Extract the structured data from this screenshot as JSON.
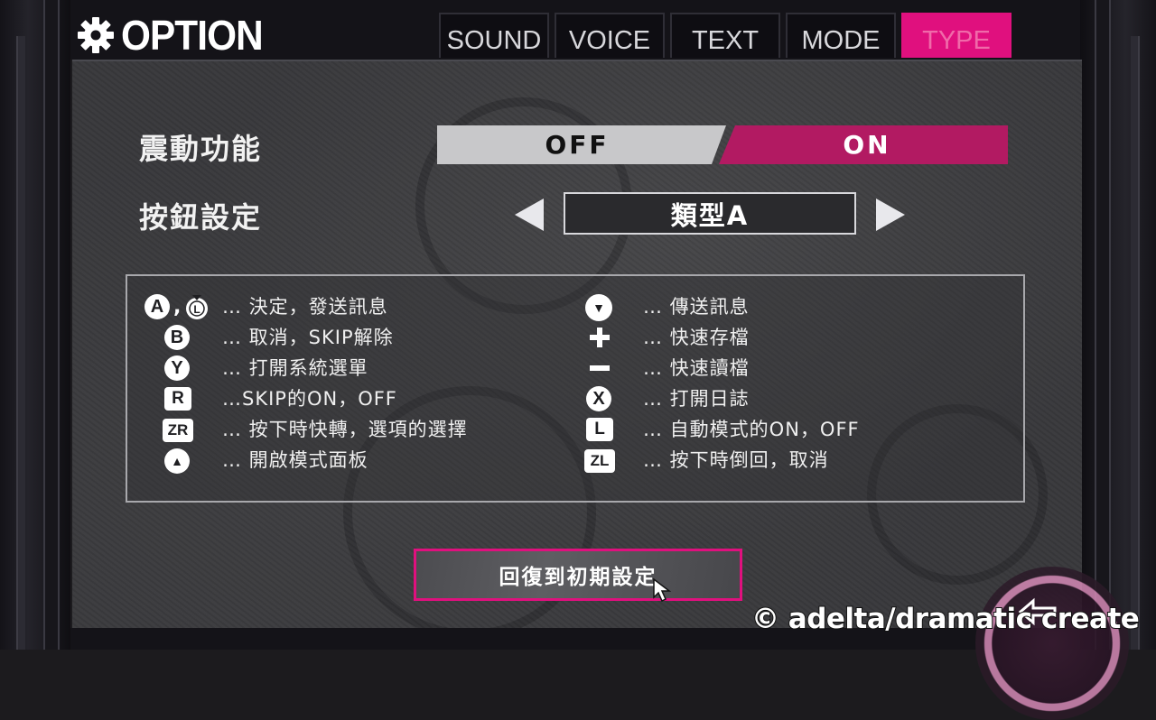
{
  "header": {
    "title": "OPTION",
    "title_icon": "gear-icon"
  },
  "tabs": [
    {
      "label": "SOUND",
      "active": false
    },
    {
      "label": "VOICE",
      "active": false
    },
    {
      "label": "TEXT",
      "active": false
    },
    {
      "label": "MODE",
      "active": false
    },
    {
      "label": "TYPE",
      "active": true
    }
  ],
  "settings": {
    "vibration": {
      "label": "震動功能",
      "off_label": "OFF",
      "on_label": "ON",
      "value": "ON"
    },
    "button_config": {
      "label": "按鈕設定",
      "value": "類型A",
      "prev_icon": "arrow-left-icon",
      "next_icon": "arrow-right-icon"
    }
  },
  "legend": {
    "left": [
      {
        "icon": "A,L",
        "icon_name": "a-button-and-l-stick-icon",
        "text": "… 決定，發送訊息"
      },
      {
        "icon": "B",
        "icon_name": "b-button-icon",
        "text": "… 取消，SKIP解除"
      },
      {
        "icon": "Y",
        "icon_name": "y-button-icon",
        "text": "… 打開系統選單"
      },
      {
        "icon": "R",
        "icon_name": "r-button-icon",
        "text": "…SKIP的ON，OFF"
      },
      {
        "icon": "ZR",
        "icon_name": "zr-button-icon",
        "text": "… 按下時快轉，選項的選擇"
      },
      {
        "icon": "▲",
        "icon_name": "dpad-up-icon",
        "text": "… 開啟模式面板"
      }
    ],
    "right": [
      {
        "icon": "▼",
        "icon_name": "dpad-down-icon",
        "text": "… 傳送訊息"
      },
      {
        "icon": "+",
        "icon_name": "plus-button-icon",
        "text": "… 快速存檔"
      },
      {
        "icon": "−",
        "icon_name": "minus-button-icon",
        "text": "… 快速讀檔"
      },
      {
        "icon": "X",
        "icon_name": "x-button-icon",
        "text": "… 打開日誌"
      },
      {
        "icon": "L",
        "icon_name": "l-button-icon",
        "text": "… 自動模式的ON，OFF"
      },
      {
        "icon": "ZL",
        "icon_name": "zl-button-icon",
        "text": "… 按下時倒回，取消"
      }
    ]
  },
  "reset_button": {
    "label": "回復到初期設定"
  },
  "watermark": "© adelta/dramatic create",
  "colors": {
    "accent": "#e0107e",
    "toggle_on": "#b21a62",
    "toggle_off": "#c8c8ca",
    "panel_bg": "#38383b"
  }
}
